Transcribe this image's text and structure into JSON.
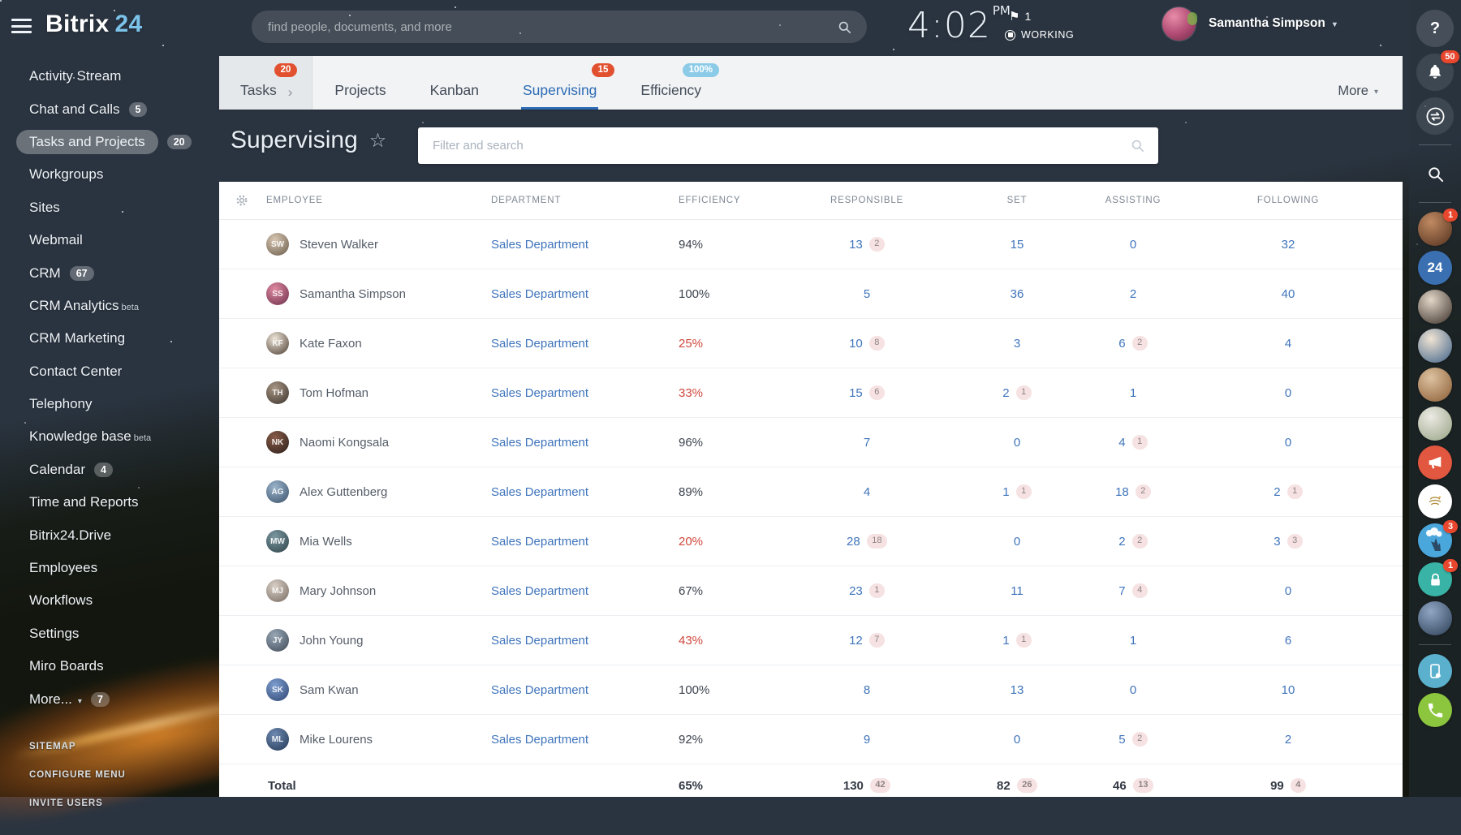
{
  "colors": {
    "accent_blue": "#2d6cb5",
    "link_blue": "#3f74bb",
    "alert_red": "#e2512f",
    "low_efficiency_red": "#d0473c",
    "badge_pink_bg": "#f6e2e2",
    "tab_bar_bg": "#f1f3f5",
    "badge_blue": "#8ccbe8"
  },
  "topbar": {
    "logo_brand": "Bitrix",
    "logo_suffix": "24",
    "search_placeholder": "find people, documents, and more",
    "time": "4:02",
    "meridiem": "PM",
    "flag_count": "1",
    "status_label": "WORKING",
    "user_name": "Samantha Simpson"
  },
  "sidebar": {
    "items": [
      {
        "label": "Activity Stream"
      },
      {
        "label": "Chat and Calls",
        "badge": "5"
      },
      {
        "label": "Tasks and Projects",
        "badge": "20",
        "active": true
      },
      {
        "label": "Workgroups"
      },
      {
        "label": "Sites"
      },
      {
        "label": "Webmail"
      },
      {
        "label": "CRM",
        "badge": "67"
      },
      {
        "label": "CRM Analytics",
        "sup": "beta"
      },
      {
        "label": "CRM Marketing"
      },
      {
        "label": "Contact Center"
      },
      {
        "label": "Telephony"
      },
      {
        "label": "Knowledge base",
        "sup": "beta"
      },
      {
        "label": "Calendar",
        "badge": "4"
      },
      {
        "label": "Time and Reports"
      },
      {
        "label": "Bitrix24.Drive"
      },
      {
        "label": "Employees"
      },
      {
        "label": "Workflows"
      },
      {
        "label": "Settings"
      },
      {
        "label": "Miro Boards"
      },
      {
        "label": "More...",
        "badge": "7",
        "caret": true
      }
    ],
    "footer_links": [
      "SITEMAP",
      "CONFIGURE MENU",
      "INVITE USERS"
    ]
  },
  "tabs": {
    "items": [
      {
        "label": "Tasks",
        "badge": "20",
        "badge_color": "red",
        "chevron": true,
        "boxed": true
      },
      {
        "label": "Projects"
      },
      {
        "label": "Kanban"
      },
      {
        "label": "Supervising",
        "badge": "15",
        "badge_color": "red",
        "active": true
      },
      {
        "label": "Efficiency",
        "badge": "100%",
        "badge_color": "blue"
      }
    ],
    "more_label": "More"
  },
  "page": {
    "title": "Supervising",
    "filter_placeholder": "Filter and search"
  },
  "table": {
    "columns": [
      "EMPLOYEE",
      "DEPARTMENT",
      "EFFICIENCY",
      "RESPONSIBLE",
      "SET",
      "ASSISTING",
      "FOLLOWING"
    ],
    "rows": [
      {
        "name": "Steven Walker",
        "department": "Sales Department",
        "efficiency": "94%",
        "low": false,
        "responsible": {
          "n": "13",
          "b": "2"
        },
        "set": {
          "n": "15"
        },
        "assisting": {
          "n": "0"
        },
        "following": {
          "n": "32"
        },
        "avatar": [
          "#d7c7b2",
          "#6a5a4a"
        ]
      },
      {
        "name": "Samantha Simpson",
        "department": "Sales Department",
        "efficiency": "100%",
        "low": false,
        "responsible": {
          "n": "5"
        },
        "set": {
          "n": "36"
        },
        "assisting": {
          "n": "2"
        },
        "following": {
          "n": "40"
        },
        "avatar": [
          "#e08aa0",
          "#6a2d4a"
        ]
      },
      {
        "name": "Kate Faxon",
        "department": "Sales Department",
        "efficiency": "25%",
        "low": true,
        "responsible": {
          "n": "10",
          "b": "8"
        },
        "set": {
          "n": "3"
        },
        "assisting": {
          "n": "6",
          "b": "2"
        },
        "following": {
          "n": "4"
        },
        "avatar": [
          "#efe6da",
          "#4a3b30"
        ]
      },
      {
        "name": "Tom Hofman",
        "department": "Sales Department",
        "efficiency": "33%",
        "low": true,
        "responsible": {
          "n": "15",
          "b": "6"
        },
        "set": {
          "n": "2",
          "b": "1"
        },
        "assisting": {
          "n": "1"
        },
        "following": {
          "n": "0"
        },
        "avatar": [
          "#a89684",
          "#3a322c"
        ]
      },
      {
        "name": "Naomi Kongsala",
        "department": "Sales Department",
        "efficiency": "96%",
        "low": false,
        "responsible": {
          "n": "7"
        },
        "set": {
          "n": "0"
        },
        "assisting": {
          "n": "4",
          "b": "1"
        },
        "following": {
          "n": "0"
        },
        "avatar": [
          "#8a5d4a",
          "#2a1d18"
        ]
      },
      {
        "name": "Alex Guttenberg",
        "department": "Sales Department",
        "efficiency": "89%",
        "low": false,
        "responsible": {
          "n": "4"
        },
        "set": {
          "n": "1",
          "b": "1"
        },
        "assisting": {
          "n": "18",
          "b": "2"
        },
        "following": {
          "n": "2",
          "b": "1"
        },
        "avatar": [
          "#9ab4cc",
          "#3a5068"
        ]
      },
      {
        "name": "Mia Wells",
        "department": "Sales Department",
        "efficiency": "20%",
        "low": true,
        "responsible": {
          "n": "28",
          "b": "18"
        },
        "set": {
          "n": "0"
        },
        "assisting": {
          "n": "2",
          "b": "2"
        },
        "following": {
          "n": "3",
          "b": "3"
        },
        "avatar": [
          "#7b98a0",
          "#2e4148"
        ]
      },
      {
        "name": "Mary Johnson",
        "department": "Sales Department",
        "efficiency": "67%",
        "low": false,
        "responsible": {
          "n": "23",
          "b": "1"
        },
        "set": {
          "n": "11"
        },
        "assisting": {
          "n": "7",
          "b": "4"
        },
        "following": {
          "n": "0"
        },
        "avatar": [
          "#d8cfc6",
          "#776a60"
        ]
      },
      {
        "name": "John Young",
        "department": "Sales Department",
        "efficiency": "43%",
        "low": true,
        "responsible": {
          "n": "12",
          "b": "7"
        },
        "set": {
          "n": "1",
          "b": "1"
        },
        "assisting": {
          "n": "1"
        },
        "following": {
          "n": "6"
        },
        "avatar": [
          "#9aa8b6",
          "#3d4854"
        ]
      },
      {
        "name": "Sam Kwan",
        "department": "Sales Department",
        "efficiency": "100%",
        "low": false,
        "responsible": {
          "n": "8"
        },
        "set": {
          "n": "13"
        },
        "assisting": {
          "n": "0"
        },
        "following": {
          "n": "10"
        },
        "avatar": [
          "#7d9ed0",
          "#2e4470"
        ]
      },
      {
        "name": "Mike Lourens",
        "department": "Sales Department",
        "efficiency": "92%",
        "low": false,
        "responsible": {
          "n": "9"
        },
        "set": {
          "n": "0"
        },
        "assisting": {
          "n": "5",
          "b": "2"
        },
        "following": {
          "n": "2"
        },
        "avatar": [
          "#6e8ab2",
          "#223754"
        ]
      }
    ],
    "total": {
      "label": "Total",
      "efficiency": "65%",
      "responsible": {
        "n": "130",
        "b": "42"
      },
      "set": {
        "n": "82",
        "b": "26"
      },
      "assisting": {
        "n": "46",
        "b": "13"
      },
      "following": {
        "n": "99",
        "b": "4"
      }
    }
  },
  "right_rail": {
    "items": [
      {
        "type": "help",
        "name": "help",
        "glyph": "?"
      },
      {
        "type": "icon",
        "name": "notifications",
        "icon": "bell",
        "badge": "50"
      },
      {
        "type": "icon",
        "name": "history",
        "icon": "history"
      },
      {
        "type": "divider"
      },
      {
        "type": "icon",
        "name": "search",
        "icon": "search"
      },
      {
        "type": "divider"
      },
      {
        "type": "avatar",
        "name": "chat-contact-1",
        "badge": "1",
        "colors": [
          "#c08a62",
          "#52301d"
        ]
      },
      {
        "type": "app",
        "name": "bitrix24-channel",
        "bg": "#3a70b2",
        "label": "24"
      },
      {
        "type": "avatar",
        "name": "chat-contact-2",
        "colors": [
          "#e2d6c8",
          "#3a2f28"
        ]
      },
      {
        "type": "avatar",
        "name": "chat-contact-3",
        "colors": [
          "#f0e4d4",
          "#3f6288"
        ]
      },
      {
        "type": "avatar",
        "name": "chat-contact-4",
        "colors": [
          "#ddc2a0",
          "#8a5c34"
        ]
      },
      {
        "type": "avatar",
        "name": "chat-contact-5",
        "colors": [
          "#eceae4",
          "#97a384"
        ]
      },
      {
        "type": "app",
        "name": "announcements",
        "bg": "#e2573f",
        "icon": "megaphone"
      },
      {
        "type": "app",
        "name": "partner-chat",
        "bg": "#ffffff",
        "icon": "partner"
      },
      {
        "type": "app",
        "name": "promo-chat",
        "bg": "#4aa7dc",
        "icon": "scene",
        "badge": "3"
      },
      {
        "type": "app",
        "name": "secure-chat",
        "bg": "#39b3a6",
        "icon": "lock",
        "badge": "1"
      },
      {
        "type": "avatar",
        "name": "chat-contact-6",
        "colors": [
          "#8fa6c4",
          "#2c3e55"
        ]
      },
      {
        "type": "divider"
      },
      {
        "type": "app",
        "name": "mobile-app",
        "bg": "#5bb1cd",
        "icon": "mobile"
      },
      {
        "type": "app",
        "name": "telephony-call",
        "bg": "#8cc63e",
        "icon": "phone"
      }
    ]
  }
}
